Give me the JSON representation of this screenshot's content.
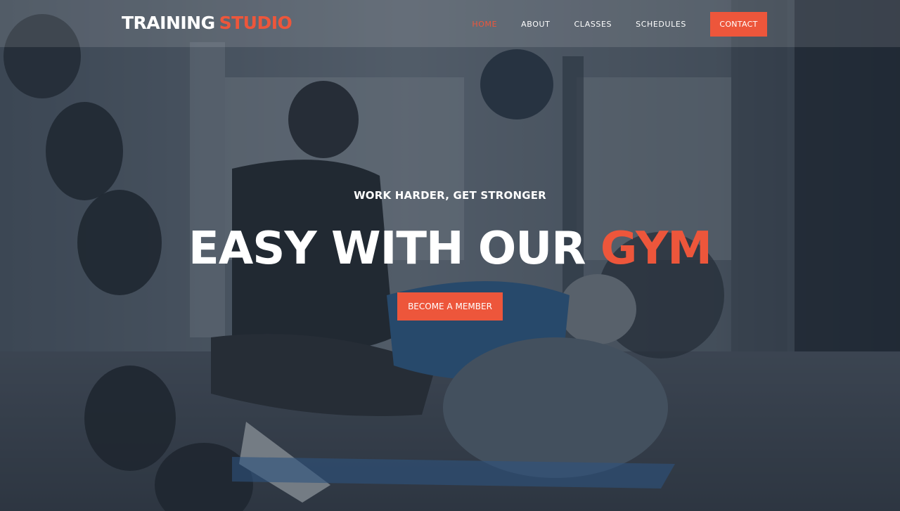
{
  "logo": {
    "part1": "TRAINING",
    "part2": "STUDIO"
  },
  "nav": {
    "items": [
      {
        "label": "HOME",
        "active": true
      },
      {
        "label": "ABOUT",
        "active": false
      },
      {
        "label": "CLASSES",
        "active": false
      },
      {
        "label": "SCHEDULES",
        "active": false
      }
    ],
    "contact_label": "CONTACT"
  },
  "hero": {
    "subtitle": "WORK HARDER, GET STRONGER",
    "title_main": "EASY WITH OUR",
    "title_accent": "GYM",
    "cta_label": "BECOME A MEMBER",
    "background_image": "gym-training-photo"
  },
  "colors": {
    "accent": "#ed563b",
    "text": "#ffffff",
    "overlay": "#232d39"
  }
}
